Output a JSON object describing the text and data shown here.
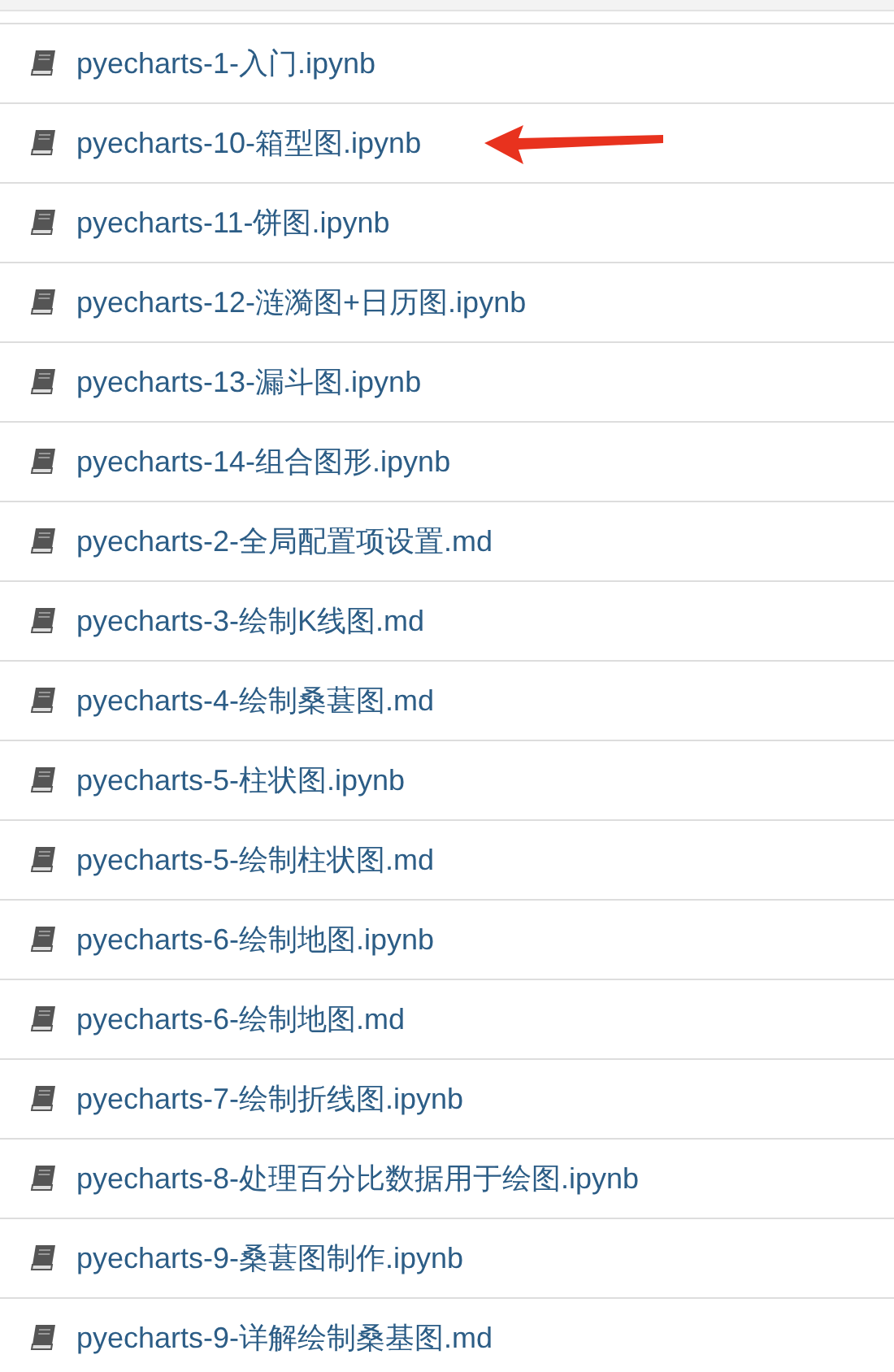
{
  "files": [
    {
      "name": "pyecharts-1-入门.ipynb",
      "arrow": false
    },
    {
      "name": "pyecharts-10-箱型图.ipynb",
      "arrow": true
    },
    {
      "name": "pyecharts-11-饼图.ipynb",
      "arrow": false
    },
    {
      "name": "pyecharts-12-涟漪图+日历图.ipynb",
      "arrow": false
    },
    {
      "name": "pyecharts-13-漏斗图.ipynb",
      "arrow": false
    },
    {
      "name": "pyecharts-14-组合图形.ipynb",
      "arrow": false
    },
    {
      "name": "pyecharts-2-全局配置项设置.md",
      "arrow": false
    },
    {
      "name": "pyecharts-3-绘制K线图.md",
      "arrow": false
    },
    {
      "name": "pyecharts-4-绘制桑葚图.md",
      "arrow": false
    },
    {
      "name": "pyecharts-5-柱状图.ipynb",
      "arrow": false
    },
    {
      "name": "pyecharts-5-绘制柱状图.md",
      "arrow": false
    },
    {
      "name": "pyecharts-6-绘制地图.ipynb",
      "arrow": false
    },
    {
      "name": "pyecharts-6-绘制地图.md",
      "arrow": false
    },
    {
      "name": "pyecharts-7-绘制折线图.ipynb",
      "arrow": false
    },
    {
      "name": "pyecharts-8-处理百分比数据用于绘图.ipynb",
      "arrow": false
    },
    {
      "name": "pyecharts-9-桑葚图制作.ipynb",
      "arrow": false
    },
    {
      "name": "pyecharts-9-详解绘制桑基图.md",
      "arrow": false
    }
  ]
}
